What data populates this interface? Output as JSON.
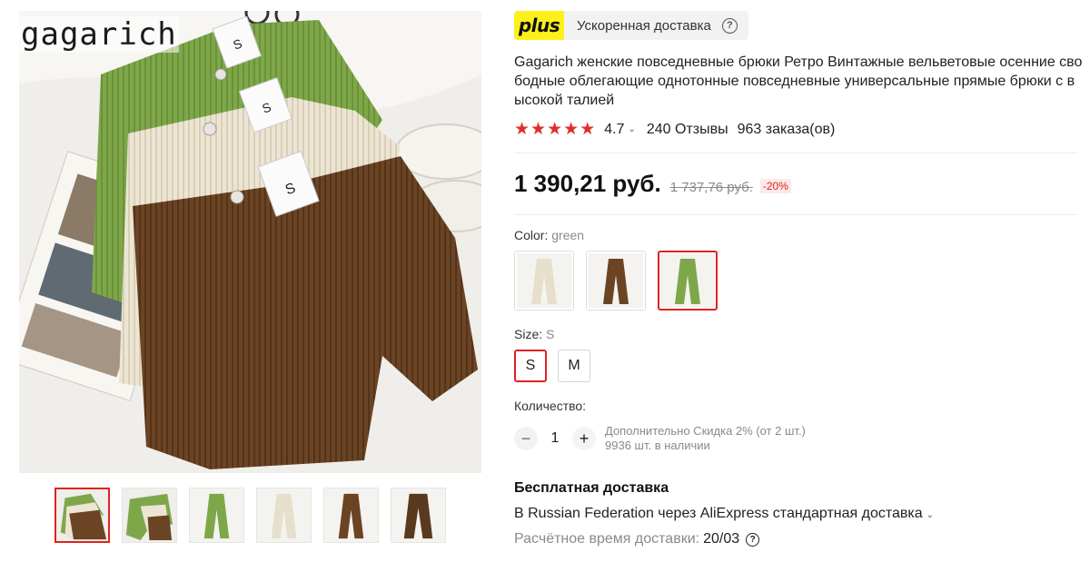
{
  "gallery": {
    "brand_watermark": "gagarich",
    "thumbnails": [
      {
        "name": "thumb-stack",
        "active": true
      },
      {
        "name": "thumb-stack-green",
        "active": false
      },
      {
        "name": "thumb-green",
        "active": false
      },
      {
        "name": "thumb-beige",
        "active": false
      },
      {
        "name": "thumb-brown",
        "active": false
      },
      {
        "name": "thumb-brown-2",
        "active": false
      }
    ]
  },
  "plus": {
    "badge": "plus",
    "text": "Ускоренная доставка",
    "help_icon": "?"
  },
  "product": {
    "title": "Gagarich женские повседневные брюки Ретро Винтажные вельветовые осенние свободные облегающие однотонные повседневные универсальные прямые брюки с высокой талией",
    "rating": "4.7",
    "reviews": "240 Отзывы",
    "orders": "963 заказа(ов)",
    "stars": 5
  },
  "price": {
    "current": "1 390,21 руб.",
    "old": "1 737,76 руб.",
    "discount": "-20%"
  },
  "color": {
    "label": "Color:",
    "selected": "green",
    "options": [
      "beige",
      "brown",
      "green"
    ]
  },
  "size": {
    "label": "Size:",
    "selected": "S",
    "options": [
      "S",
      "M"
    ]
  },
  "quantity": {
    "label": "Количество:",
    "value": "1",
    "minus": "−",
    "plus": "+",
    "extra_discount": "Дополнительно Скидка 2% (от 2 шт.)",
    "stock": "9936 шт. в наличии"
  },
  "delivery": {
    "title": "Бесплатная доставка",
    "route": "В Russian Federation через AliExpress стандартная доставка",
    "time_label": "Расчётное время доставки:",
    "time_value": "20/03"
  },
  "colors": {
    "accent": "#e0221f",
    "star": "#e42b2b",
    "plus_badge": "#fcf01b"
  }
}
